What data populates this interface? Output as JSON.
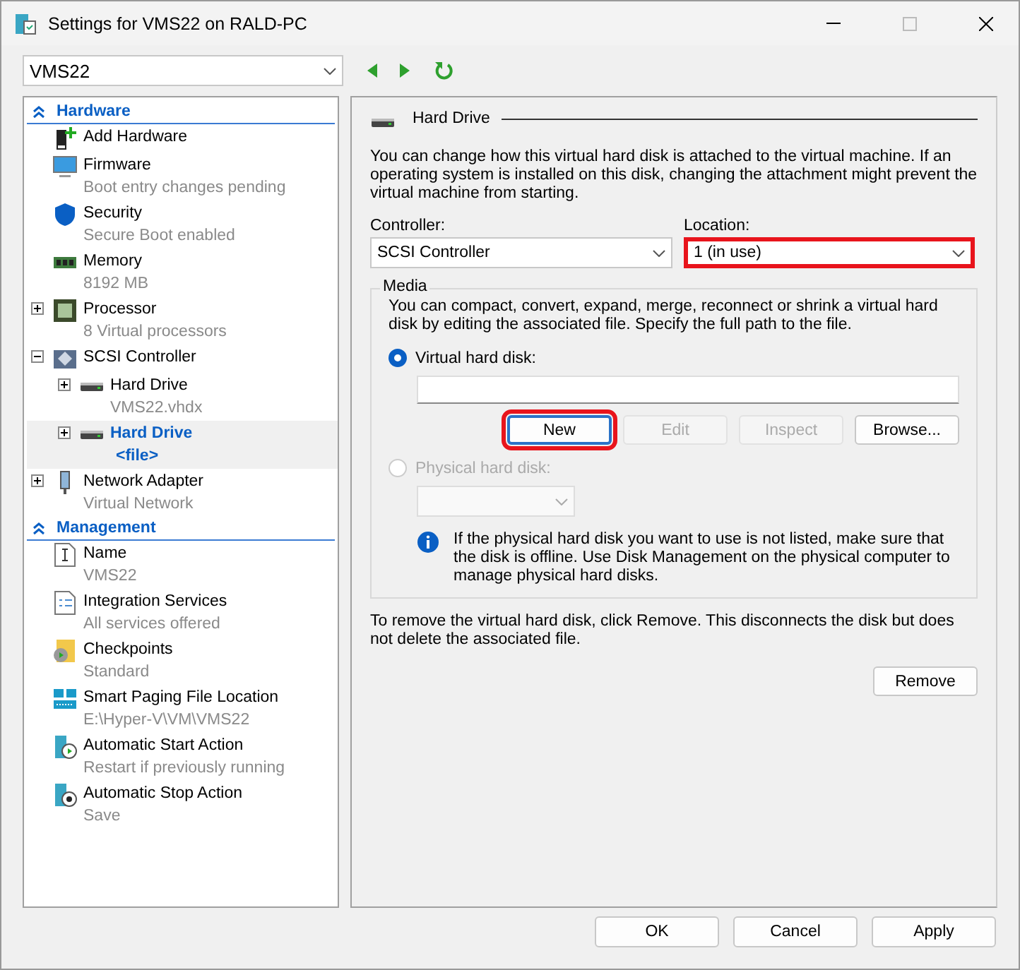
{
  "window": {
    "title": "Settings for VMS22 on RALD-PC"
  },
  "toolbar": {
    "vm_select": {
      "value": "VMS22"
    }
  },
  "sidebar": {
    "sections": [
      {
        "title": "Hardware",
        "items": [
          {
            "kind": "hardware",
            "label": "Add Hardware",
            "selected": false
          },
          {
            "kind": "firmware",
            "label": "Firmware",
            "detail": "Boot entry changes pending",
            "selected": false
          },
          {
            "kind": "security",
            "label": "Security",
            "detail": "Secure Boot enabled",
            "selected": false
          },
          {
            "kind": "memory",
            "label": "Memory",
            "detail": "8192 MB",
            "selected": false
          },
          {
            "kind": "processor",
            "label": "Processor",
            "detail": "8 Virtual processors",
            "expanded": false,
            "selected": false
          },
          {
            "kind": "controller",
            "label": "SCSI Controller",
            "expanded": true,
            "selected": false,
            "children": [
              {
                "kind": "drive",
                "label": "Hard Drive",
                "detail": "VMS22.vhdx",
                "expanded": false,
                "selected": false
              },
              {
                "kind": "drive",
                "label": "Hard Drive",
                "detail": "<file>",
                "expanded": false,
                "selected": true
              }
            ]
          },
          {
            "kind": "network",
            "label": "Network Adapter",
            "detail": "Virtual Network",
            "expanded": false,
            "selected": false
          }
        ]
      },
      {
        "title": "Management",
        "items": [
          {
            "kind": "name",
            "label": "Name",
            "detail": "VMS22",
            "selected": false
          },
          {
            "kind": "integration",
            "label": "Integration Services",
            "detail": "All services offered",
            "selected": false
          },
          {
            "kind": "checkpoints",
            "label": "Checkpoints",
            "detail": "Standard",
            "selected": false
          },
          {
            "kind": "paging",
            "label": "Smart Paging File Location",
            "detail": "E:\\Hyper-V\\VM\\VMS22",
            "selected": false
          },
          {
            "kind": "start",
            "label": "Automatic Start Action",
            "detail": "Restart if previously running",
            "selected": false
          },
          {
            "kind": "stop",
            "label": "Automatic Stop Action",
            "detail": "Save",
            "selected": false
          }
        ]
      }
    ]
  },
  "panel": {
    "title": "Hard Drive",
    "intro": "You can change how this virtual hard disk is attached to the virtual machine. If an operating system is installed on this disk, changing the attachment might prevent the virtual machine from starting.",
    "controller": {
      "label": "Controller:",
      "value": "SCSI Controller",
      "highlighted": false
    },
    "location": {
      "label": "Location:",
      "value": "1 (in use)",
      "highlighted": true
    },
    "media": {
      "title": "Media",
      "description": "You can compact, convert, expand, merge, reconnect or shrink a virtual hard disk by editing the associated file. Specify the full path to the file.",
      "virtual_radio": {
        "label": "Virtual hard disk:",
        "selected": true,
        "disabled": false
      },
      "buttons": [
        {
          "label": "New",
          "disabled": false,
          "highlighted": true
        },
        {
          "label": "Edit",
          "disabled": true,
          "highlighted": false
        },
        {
          "label": "Inspect",
          "disabled": true,
          "highlighted": false
        },
        {
          "label": "Browse...",
          "disabled": false,
          "highlighted": false
        }
      ],
      "physical_radio": {
        "label": "Physical hard disk:",
        "selected": false,
        "disabled": true
      },
      "info": "If the physical hard disk you want to use is not listed, make sure that the disk is offline. Use Disk Management on the physical computer to manage physical hard disks."
    },
    "remove_note": "To remove the virtual hard disk, click Remove. This disconnects the disk but does not delete the associated file.",
    "remove_button": "Remove"
  },
  "footer": {
    "buttons": [
      "OK",
      "Cancel",
      "Apply"
    ]
  }
}
